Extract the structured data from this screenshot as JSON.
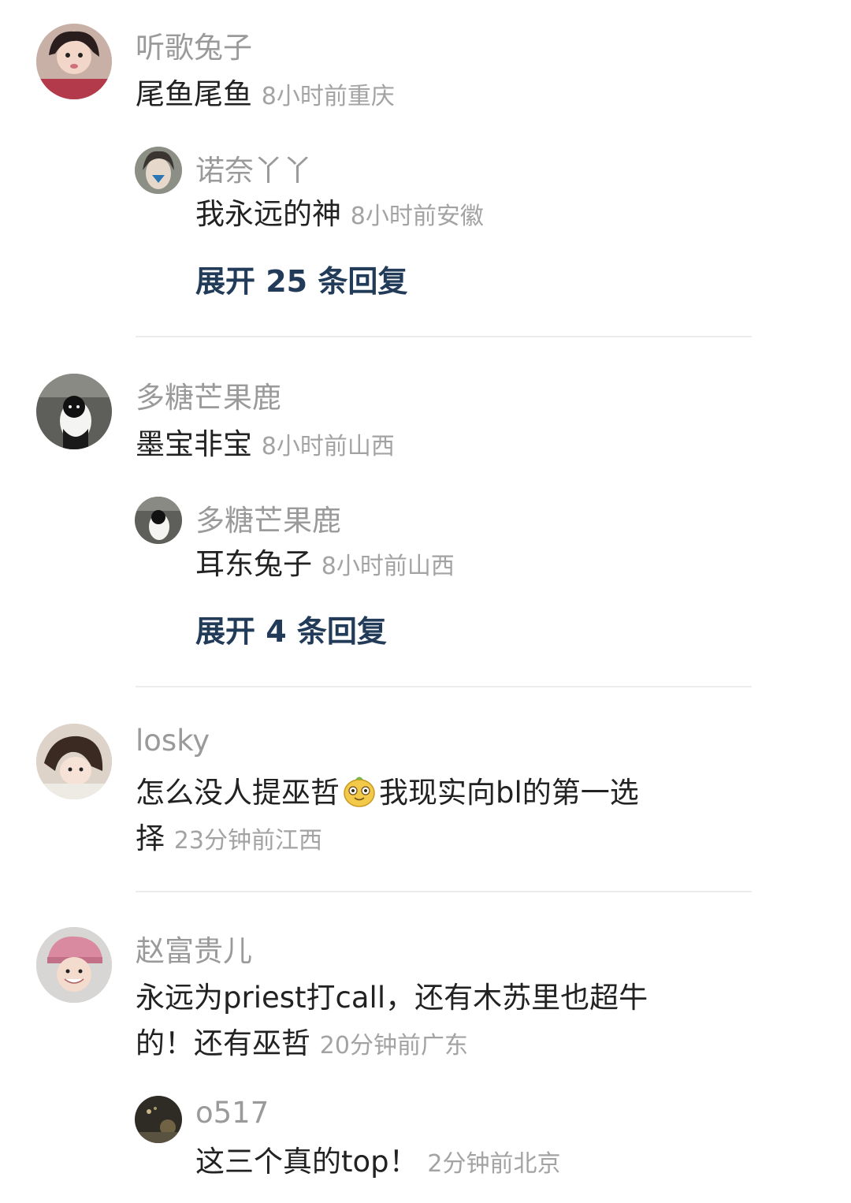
{
  "comments": [
    {
      "user": "听歌兔子",
      "text": "尾鱼尾鱼",
      "time": "8小时前",
      "location": "重庆",
      "reply": {
        "user": "诺奈丫丫",
        "text": "我永远的神",
        "time": "8小时前",
        "location": "安徽"
      },
      "expand": "展开 25 条回复"
    },
    {
      "user": "多糖芒果鹿",
      "text": "墨宝非宝",
      "time": "8小时前",
      "location": "山西",
      "reply": {
        "user": "多糖芒果鹿",
        "text": "耳东兔子",
        "time": "8小时前",
        "location": "山西"
      },
      "expand": "展开 4 条回复"
    },
    {
      "user": "losky",
      "text_part1": "怎么没人提巫哲",
      "text_part2": "我现实向bl的第一选",
      "text_line2": "择",
      "time": "23分钟前",
      "location": "江西"
    },
    {
      "user": "赵富贵儿",
      "text_line1": "永远为priest打call，还有木苏里也超牛",
      "text_line2": "的！还有巫哲",
      "time": "20分钟前",
      "location": "广东",
      "reply": {
        "user": "o517",
        "text": "这三个真的top！",
        "time": "2分钟前",
        "location": "北京"
      }
    }
  ],
  "icons": {
    "emoji": "smiling-pear-emoji"
  },
  "colors": {
    "username": "#9a9a9a",
    "text": "#222222",
    "meta": "#a3a3a3",
    "expand": "#213b59"
  }
}
